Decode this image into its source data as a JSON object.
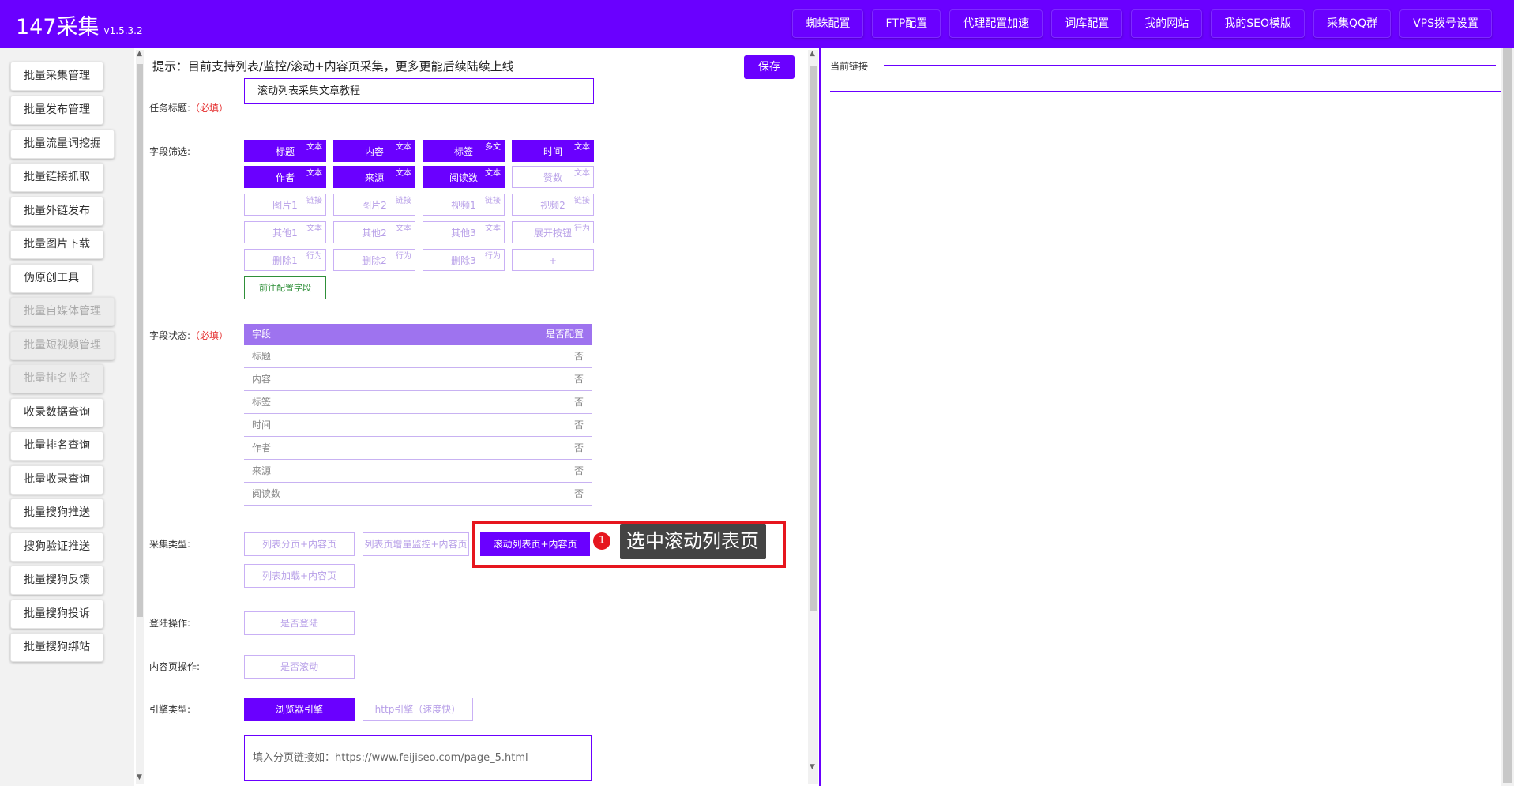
{
  "header": {
    "brand": "147采集",
    "version": "v1.5.3.2",
    "nav": [
      "蜘蛛配置",
      "FTP配置",
      "代理配置加速",
      "词库配置",
      "我的网站",
      "我的SEO模版",
      "采集QQ群",
      "VPS拨号设置"
    ]
  },
  "sidebar": {
    "items": [
      {
        "label": "批量采集管理",
        "disabled": false
      },
      {
        "label": "批量发布管理",
        "disabled": false
      },
      {
        "label": "批量流量词挖掘",
        "disabled": false
      },
      {
        "label": "批量链接抓取",
        "disabled": false
      },
      {
        "label": "批量外链发布",
        "disabled": false
      },
      {
        "label": "批量图片下载",
        "disabled": false
      },
      {
        "label": "伪原创工具",
        "disabled": false
      },
      {
        "label": "批量自媒体管理",
        "disabled": true
      },
      {
        "label": "批量短视频管理",
        "disabled": true
      },
      {
        "label": "批量排名监控",
        "disabled": true
      },
      {
        "label": "收录数据查询",
        "disabled": false
      },
      {
        "label": "批量排名查询",
        "disabled": false
      },
      {
        "label": "批量收录查询",
        "disabled": false
      },
      {
        "label": "批量搜狗推送",
        "disabled": false
      },
      {
        "label": "搜狗验证推送",
        "disabled": false
      },
      {
        "label": "批量搜狗反馈",
        "disabled": false
      },
      {
        "label": "批量搜狗投诉",
        "disabled": false
      },
      {
        "label": "批量搜狗绑站",
        "disabled": false
      }
    ]
  },
  "main": {
    "hint": "提示：目前支持列表/监控/滚动+内容页采集，更多更能后续陆续上线",
    "save_label": "保存",
    "task_title_label": "任务标题:",
    "required_mark": "（必填）",
    "task_title_value": "滚动列表采集文章教程",
    "field_filter_label": "字段筛选:",
    "fields": [
      {
        "name": "标题",
        "tag": "文本",
        "active": true
      },
      {
        "name": "内容",
        "tag": "文本",
        "active": true
      },
      {
        "name": "标签",
        "tag": "多文",
        "active": true
      },
      {
        "name": "时间",
        "tag": "文本",
        "active": true
      },
      {
        "name": "作者",
        "tag": "文本",
        "active": true
      },
      {
        "name": "来源",
        "tag": "文本",
        "active": true
      },
      {
        "name": "阅读数",
        "tag": "文本",
        "active": true
      },
      {
        "name": "赞数",
        "tag": "文本",
        "active": false
      },
      {
        "name": "图片1",
        "tag": "链接",
        "active": false
      },
      {
        "name": "图片2",
        "tag": "链接",
        "active": false
      },
      {
        "name": "视频1",
        "tag": "链接",
        "active": false
      },
      {
        "name": "视频2",
        "tag": "链接",
        "active": false
      },
      {
        "name": "其他1",
        "tag": "文本",
        "active": false
      },
      {
        "name": "其他2",
        "tag": "文本",
        "active": false
      },
      {
        "name": "其他3",
        "tag": "文本",
        "active": false
      },
      {
        "name": "展开按钮",
        "tag": "行为",
        "active": false
      },
      {
        "name": "删除1",
        "tag": "行为",
        "active": false
      },
      {
        "name": "删除2",
        "tag": "行为",
        "active": false
      },
      {
        "name": "删除3",
        "tag": "行为",
        "active": false
      },
      {
        "name": "+",
        "tag": "",
        "active": false
      }
    ],
    "goto_config": "前往配置字段",
    "field_status_label": "字段状态:",
    "status_table": {
      "headers": [
        "字段",
        "是否配置"
      ],
      "rows": [
        [
          "标题",
          "否"
        ],
        [
          "内容",
          "否"
        ],
        [
          "标签",
          "否"
        ],
        [
          "时间",
          "否"
        ],
        [
          "作者",
          "否"
        ],
        [
          "来源",
          "否"
        ],
        [
          "阅读数",
          "否"
        ]
      ]
    },
    "collect_type_label": "采集类型:",
    "collect_types": [
      "列表分页+内容页",
      "列表页增量监控+内容页",
      "滚动列表页+内容页",
      "列表加载+内容页"
    ],
    "collect_type_selected": "滚动列表页+内容页",
    "annotation": {
      "number": "1",
      "text": "选中滚动列表页"
    },
    "login_label": "登陆操作:",
    "login_btn": "是否登陆",
    "content_op_label": "内容页操作:",
    "content_op_btn": "是否滚动",
    "engine_label": "引擎类型:",
    "engines": [
      "浏览器引擎",
      "http引擎（速度快）"
    ],
    "engine_selected": "浏览器引擎",
    "url_placeholder": "填入分页链接如：https://www.feijiseo.com/page_5.html"
  },
  "right_panel": {
    "current_link_label": "当前链接"
  },
  "colors": {
    "brand": "#6a00ff",
    "highlight_box": "#e6161e",
    "required": "#e53030"
  }
}
